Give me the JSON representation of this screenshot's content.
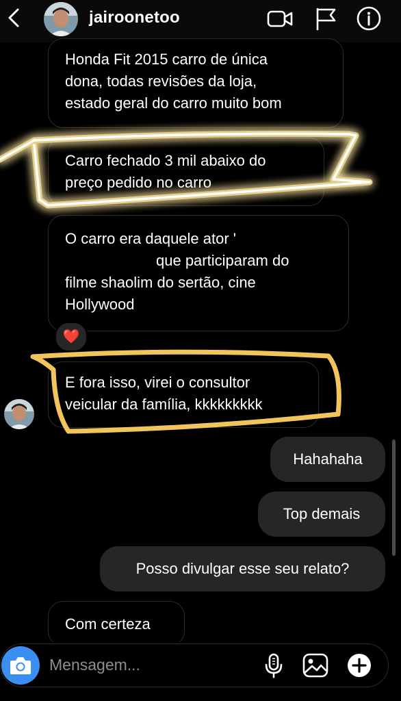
{
  "header": {
    "username": "jairoonetoo",
    "icons": [
      "back-icon",
      "video-camera-icon",
      "flag-icon",
      "info-icon"
    ]
  },
  "messages": [
    {
      "direction": "received",
      "lines": [
        "Honda Fit 2015 carro de única",
        "dona, todas revisões da loja,",
        "estado geral do carro muito bom"
      ]
    },
    {
      "direction": "received",
      "lines": [
        "Carro fechado 3 mil abaixo do",
        "preço pedido no carro"
      ],
      "highlight": "glowing white scribble"
    },
    {
      "direction": "received",
      "lines": [
        "O carro era daquele ator '",
        "que participaram do",
        "filme shaolim do sertão, cine",
        "Hollywood"
      ],
      "reaction": "❤️"
    },
    {
      "direction": "received",
      "lines": [
        "E fora isso, virei o consultor",
        "veicular da família, kkkkkkkkk"
      ],
      "highlight": "yellow marker outline"
    },
    {
      "direction": "sent",
      "text": "Hahahaha"
    },
    {
      "direction": "sent",
      "text": "Top demais"
    },
    {
      "direction": "sent",
      "text": "Posso divulgar esse seu relato?"
    },
    {
      "direction": "received",
      "lines": [
        "Com certeza"
      ]
    }
  ],
  "composer": {
    "placeholder": "Mensagem...",
    "icons": [
      "camera-icon",
      "microphone-icon",
      "gallery-icon",
      "plus-icon"
    ]
  },
  "colors": {
    "background": "#000000",
    "sent_bubble": "#262626",
    "received_border": "#2c2c2c",
    "camera_button": "#3c8ff2",
    "glow_highlight": "#ffe9a8",
    "marker_highlight": "#f2c55c"
  }
}
